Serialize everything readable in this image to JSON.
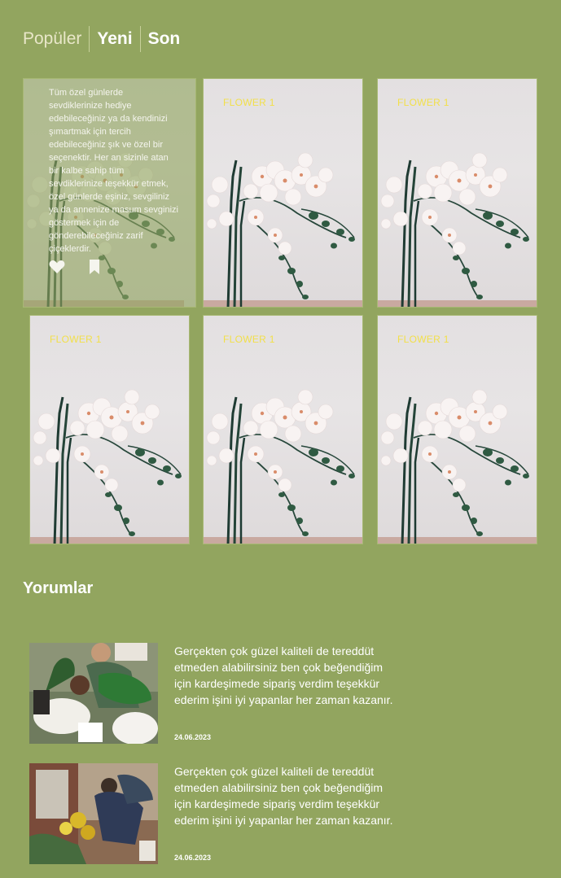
{
  "tabs": [
    {
      "label": "Popüler"
    },
    {
      "label": "Yeni"
    },
    {
      "label": "Son"
    }
  ],
  "products": [
    {
      "label": "FLOWER 1"
    },
    {
      "label": "FLOWER 1"
    },
    {
      "label": "FLOWER 1"
    },
    {
      "label": "FLOWER 1"
    },
    {
      "label": "FLOWER 1"
    }
  ],
  "active_card": {
    "description": "Tüm özel günlerde sevdiklerinize hediye edebileceğiniz ya da kendinizi şımartmak için tercih edebileceğiniz şık ve özel bir seçenektir. Her an sizinle atan bir kalbe sahip tüm sevdiklerinize teşekkür etmek, özel günlerde eşiniz, sevgiliniz ya da annenize masum sevginizi göstermek için de gönderebileceğiniz zarif çiçeklerdir.",
    "like_icon": "heart-icon",
    "save_icon": "bookmark-icon"
  },
  "reviews_section": {
    "title": "Yorumlar",
    "reviews": [
      {
        "text": "Gerçekten çok güzel kaliteli de tereddüt etmeden alabilirsiniz ben çok beğendiğim için kardeşimede sipariş verdim teşekkür ederim işini iyi yapanlar her zaman kazanır.",
        "date": "24.06.2023"
      },
      {
        "text": "Gerçekten çok güzel kaliteli de tereddüt etmeden alabilirsiniz ben çok beğendiğim için kardeşimede sipariş verdim teşekkür ederim işini iyi yapanlar her zaman kazanır.",
        "date": "24.06.2023"
      }
    ]
  },
  "colors": {
    "background": "#92a55f",
    "label": "#f2e04a",
    "tab_inactive": "#e9e7c9"
  }
}
